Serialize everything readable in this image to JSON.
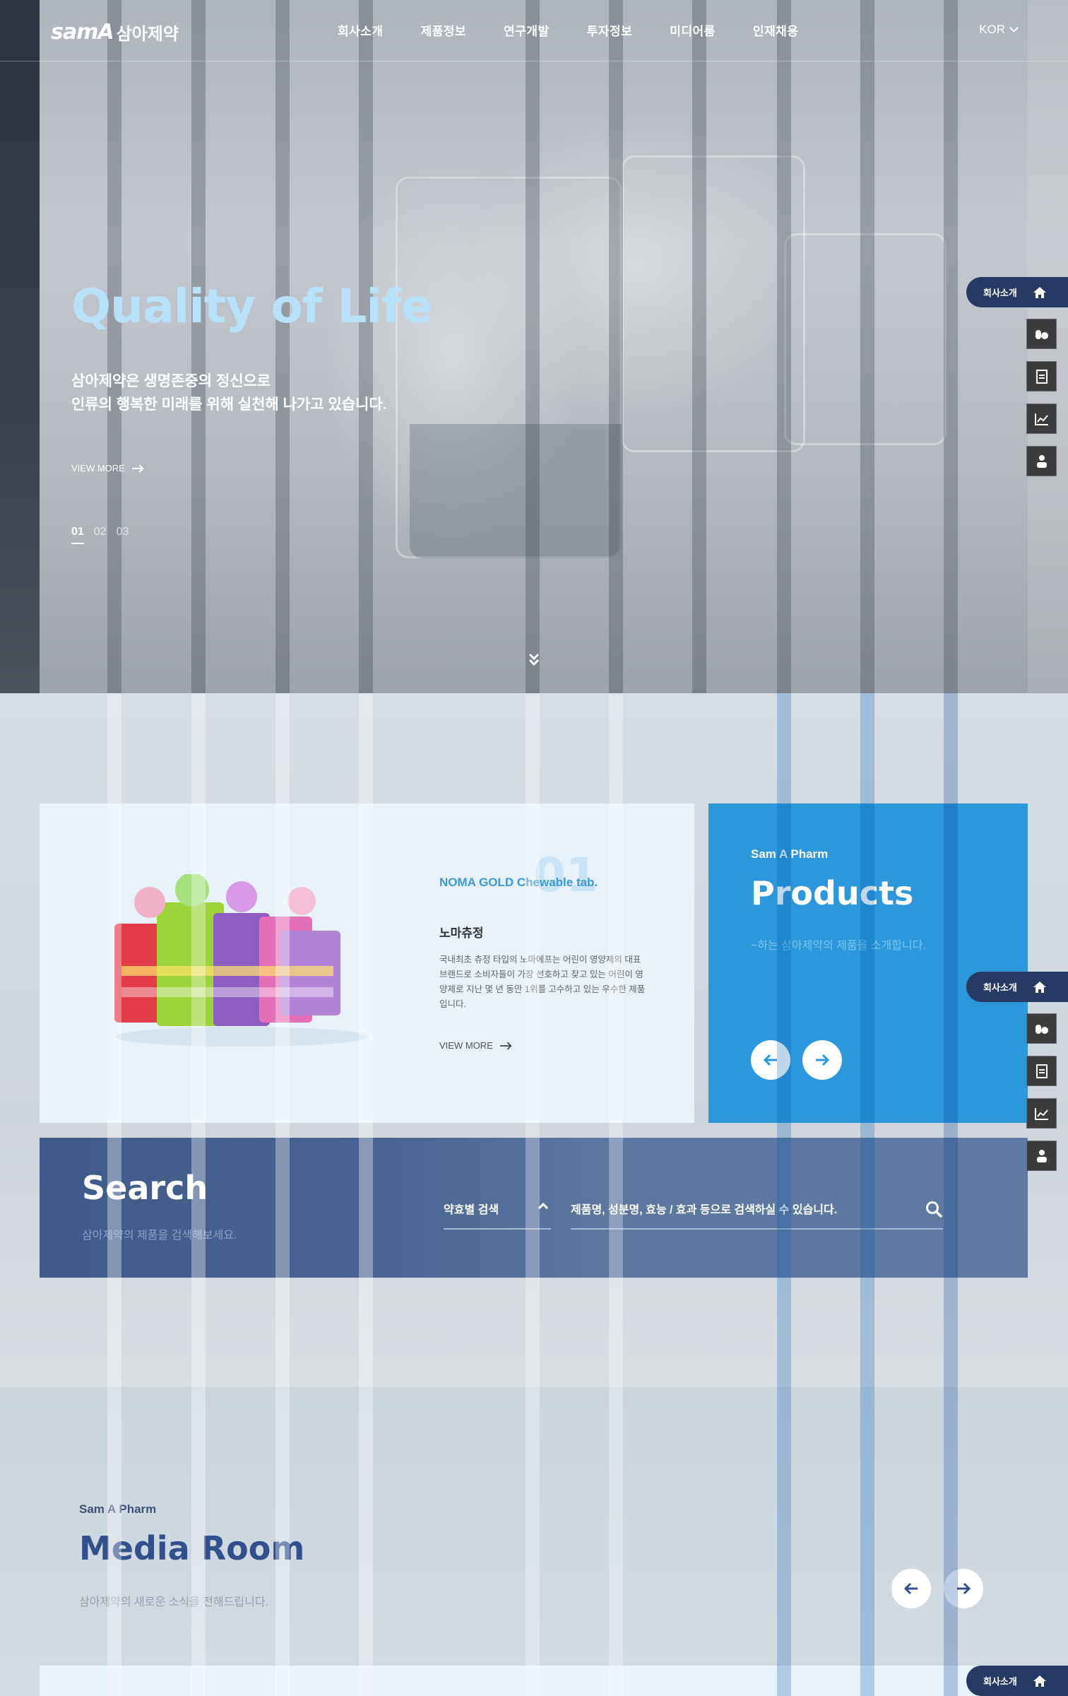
{
  "header": {
    "logo_mark": "samA",
    "logo_text": "삼아제약",
    "nav": [
      "회사소개",
      "제품정보",
      "연구개발",
      "투자정보",
      "미디어룸",
      "인재채용"
    ],
    "lang": "KOR"
  },
  "hero": {
    "title": "Quality of Life",
    "desc_line1": "삼아제약은 생명존중의 정신으로",
    "desc_line2": "인류의 행복한 미래를 위해 실천해 나가고 있습니다.",
    "more": "VIEW MORE",
    "pager": [
      "01",
      "02",
      "03"
    ],
    "active_slide": "01"
  },
  "quick_menu": {
    "home_label": "회사소개",
    "icons": [
      "home-icon",
      "pills-icon",
      "document-icon",
      "chart-icon",
      "people-icon"
    ]
  },
  "product": {
    "index": "01",
    "name_en": "NOMA GOLD Chewable tab.",
    "name_ko": "노마츄정",
    "desc": "국내최초 츄정 타입의 노마에프는 어린이 영양제의 대표 브랜드로 소비자들이 가장 선호하고 찾고 있는 어린이 영양제로 지난 몇 년 동안 1위를 고수하고 있는 우수한 제품입니다.",
    "more": "VIEW MORE"
  },
  "products_panel": {
    "sub": "Sam A Pharm",
    "title": "Products",
    "desc": "~하는 삼아제약의 제품을 소개합니다."
  },
  "search": {
    "title": "Search",
    "desc": "삼아제약의 제품을 검색해보세요.",
    "category": "약효별 검색",
    "placeholder": "제품명, 성분명, 효능 / 효과 등으로 검색하실 수 있습니다."
  },
  "media": {
    "sub": "Sam A Pharm",
    "title": "Media Room",
    "desc": "삼아제약의 새로운 소식을 전해드립니다."
  },
  "colors": {
    "accent_blue": "#2c97db",
    "navy": "#263a63",
    "hero_title": "#b9e1f8"
  }
}
